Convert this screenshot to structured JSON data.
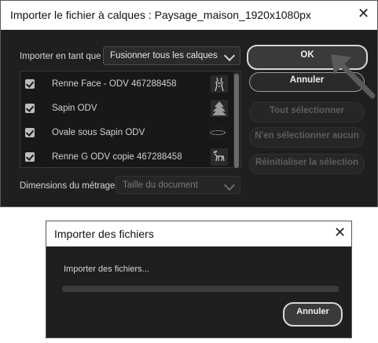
{
  "dialog1": {
    "title": "Importer le fichier à calques : Paysage_maison_1920x1080px",
    "import_as_label": "Importer en tant que",
    "import_as_value": "Fusionner tous les calques",
    "layers": [
      {
        "name": "Renne Face - ODV 467288458",
        "checked": true
      },
      {
        "name": "Sapin ODV",
        "checked": true
      },
      {
        "name": "Ovale sous Sapin ODV",
        "checked": true
      },
      {
        "name": "Renne G ODV copie 467288458",
        "checked": true
      }
    ],
    "footage_label": "Dimensions du métrage",
    "footage_value": "Taille du document",
    "buttons": {
      "ok": "OK",
      "cancel": "Annuler",
      "select_all": "Tout sélectionner",
      "select_none": "N'en sélectionner aucun",
      "reset": "Réinitialiser la sélection"
    }
  },
  "dialog2": {
    "title": "Importer des fichiers",
    "status": "Importer des fichiers...",
    "progress": 0,
    "cancel": "Annuler"
  },
  "colors": {
    "dialog_bg": "#1f1f1f",
    "titlebar_bg": "#ffffff",
    "arrow": "#5a5a5a"
  }
}
